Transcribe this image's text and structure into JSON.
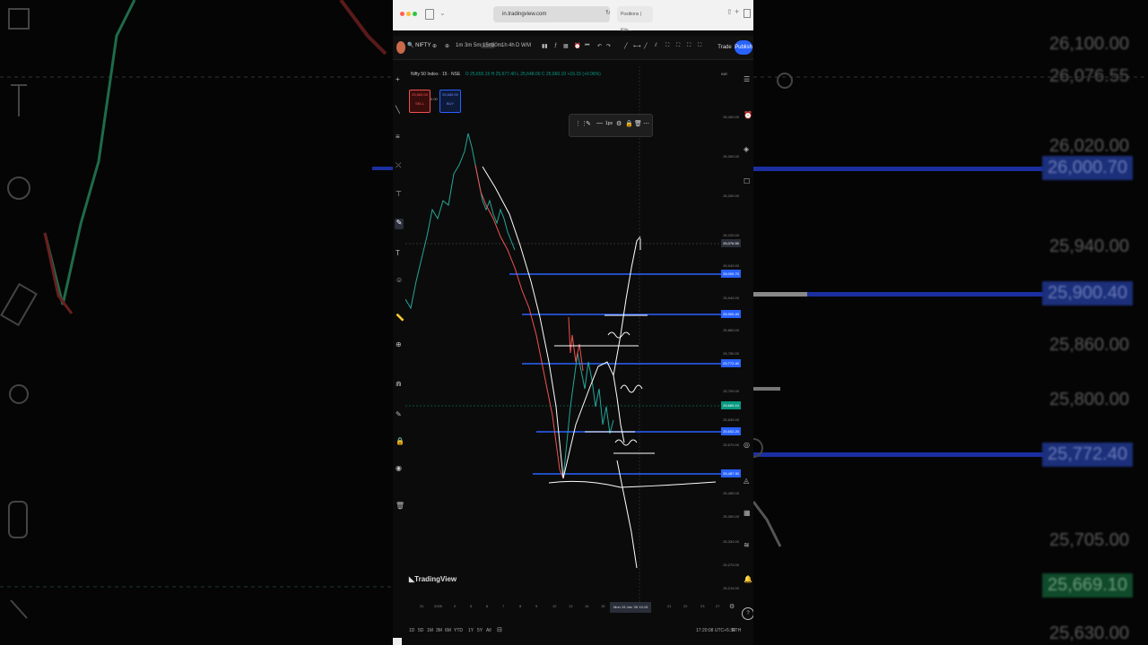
{
  "browser": {
    "url": "in.tradingview.com",
    "tab_label": "Positions | Kite..."
  },
  "toolbar": {
    "symbol": "NIFTY",
    "intervals": [
      "1m",
      "3m",
      "5m",
      "15m",
      "30m",
      "1h",
      "4h",
      "D",
      "W",
      "M"
    ],
    "active_interval": "15m",
    "trade_label": "Trade",
    "publish_label": "Publish"
  },
  "chart": {
    "title": "Nifty 50 Index · 15 · NSE",
    "ohlc": "O 25,655.15 H 25,677.40 L 25,648.00 C 25,660.10 +16.15 (+0.06%)",
    "sell_price": "25,660.00",
    "sell_label": "SELL",
    "buy_price": "25,665.00",
    "buy_label": "BUY",
    "mid_value": "0.00",
    "currency": "INR",
    "watermark": "TradingView"
  },
  "price_axis": {
    "ticks": [
      "26,400.00",
      "26,300.00",
      "26,200.00",
      "26,100.00",
      "26,040.00",
      "25,940.00",
      "25,860.00",
      "25,780.00",
      "25,700.00",
      "25,630.00",
      "25,570.00",
      "25,455.00",
      "25,390.00",
      "25,330.00",
      "25,270.00",
      "25,214.00"
    ],
    "labels": [
      {
        "value": "26,076.55",
        "color": "#2a2e39"
      },
      {
        "value": "26,000.70",
        "color": "#2962ff"
      },
      {
        "value": "25,900.40",
        "color": "#2962ff"
      },
      {
        "value": "25,772.40",
        "color": "#2962ff"
      },
      {
        "value": "25,669.10",
        "color": "#089981"
      },
      {
        "value": "25,602.20",
        "color": "#2962ff"
      },
      {
        "value": "25,487.30",
        "color": "#2962ff"
      }
    ]
  },
  "date_axis": {
    "ticks": [
      "31",
      "2026",
      "2",
      "5",
      "6",
      "7",
      "8",
      "9",
      "12",
      "13",
      "14",
      "15",
      "16",
      "21",
      "22",
      "23",
      "27"
    ],
    "cursor_label": "Mon 19 Jan '26  10:15"
  },
  "bottom_bar": {
    "ranges": [
      "1D",
      "5D",
      "1M",
      "3M",
      "6M",
      "YTD",
      "1Y",
      "5Y",
      "All"
    ],
    "clock": "17:20:08 UTC+5:30",
    "session": "RTH"
  },
  "background": {
    "right_labels": [
      "26,100.00",
      "26,076.55",
      "26,020.00",
      "26,000.70",
      "25,940.00",
      "25,900.40",
      "25,860.00",
      "25,800.00",
      "25,772.40",
      "25,705.00",
      "25,669.10",
      "25,630.00"
    ]
  }
}
